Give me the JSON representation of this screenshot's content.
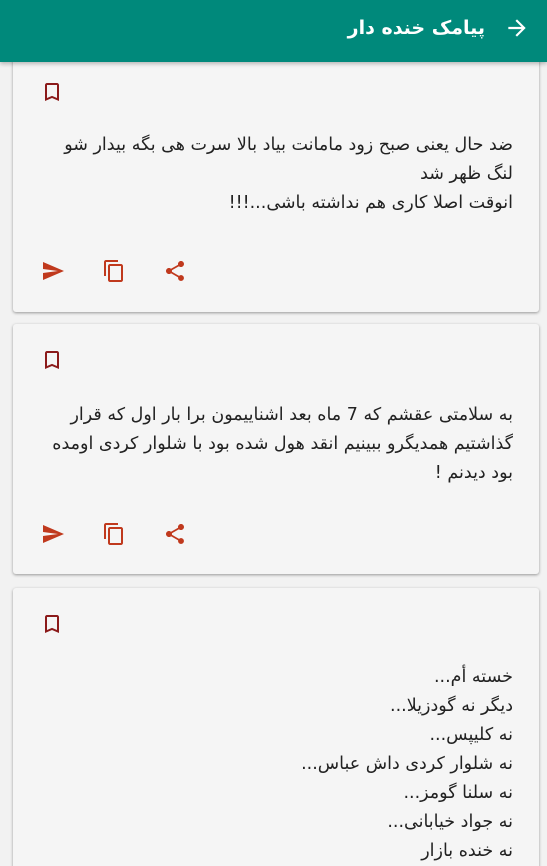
{
  "header": {
    "title": "پیامک خنده دار",
    "back_icon": "arrow-forward-icon",
    "background": "#00897b",
    "text_color": "#ffffff"
  },
  "accent_color": "#c0391d",
  "cards": [
    {
      "bookmark_icon": "bookmark-outline-icon",
      "text": "ضد حال یعنی صبح زود مامانت بیاد بالا سرت هی بگه بیدار شو لنگ ظهر شد\nانوقت اصلا کاری هم نداشته باشی...!!!",
      "actions": [
        "send-icon",
        "copy-icon",
        "share-icon"
      ]
    },
    {
      "bookmark_icon": "bookmark-outline-icon",
      "text": "به سلامتی عقشم که 7 ماه بعد اشناییمون برا بار اول که قرار گذاشتیم همدیگرو ببینیم انقد هول شده بود با شلوار کردی اومده بود دیدنم !",
      "actions": [
        "send-icon",
        "copy-icon",
        "share-icon"
      ]
    },
    {
      "bookmark_icon": "bookmark-outline-icon",
      "text": "خسته أم...\nدیگر نه گودزیلا...\nنه کلیپس...\nنه شلوار کردی داش عباس...\nنه سلنا گومز...\nنه جواد خیابانی...\nنه خنده بازار",
      "actions": []
    }
  ]
}
